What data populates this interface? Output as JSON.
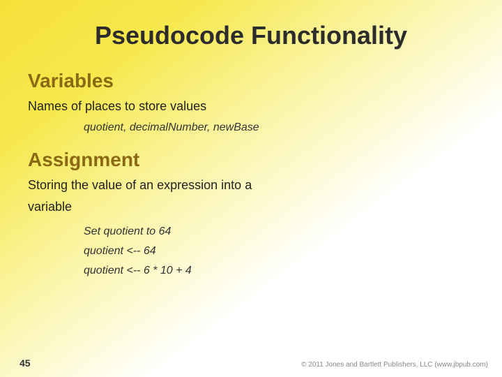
{
  "slide": {
    "title": "Pseudocode Functionality",
    "sections": [
      {
        "id": "variables",
        "heading": "Variables",
        "body": "Names of places to store values",
        "examples": [
          "quotient, decimalNumber, newBase"
        ]
      },
      {
        "id": "assignment",
        "heading": "Assignment",
        "body_lines": [
          "Storing the value of an expression into a",
          "variable"
        ],
        "examples": [
          "Set quotient to 64",
          "quotient <-- 64",
          "quotient <-- 6 * 10 + 4"
        ]
      }
    ],
    "slide_number": "45",
    "copyright": "© 2011 Jones and Bartlett Publishers, LLC (www.jbpub.com)"
  }
}
